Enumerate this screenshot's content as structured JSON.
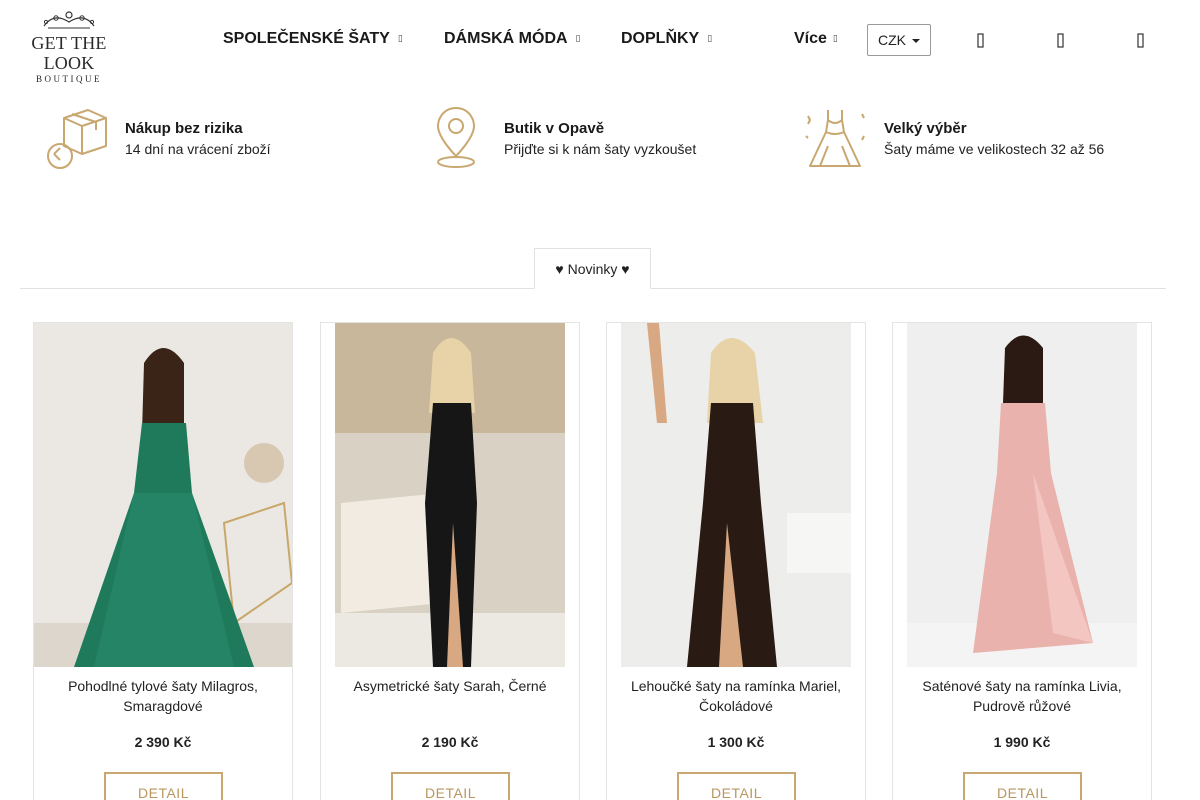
{
  "header": {
    "logo": {
      "brand": "GET THE LOOK",
      "sub": "BOUTIQUE"
    },
    "nav": [
      {
        "label": "SPOLEČENSKÉ ŠATY",
        "caret": "▯"
      },
      {
        "label": "DÁMSKÁ MÓDA",
        "caret": "▯"
      },
      {
        "label": "DOPLŇKY",
        "caret": "▯"
      }
    ],
    "more": {
      "label": "Více",
      "caret": "▯"
    },
    "currency": "CZK",
    "icons": [
      "search-icon",
      "user-icon",
      "cart-icon"
    ]
  },
  "benefits": [
    {
      "title": "Nákup bez rizika",
      "text": "14 dní na vrácení zboží",
      "icon": "return-box-icon"
    },
    {
      "title": "Butik v Opavě",
      "text": "Přijďte si k nám šaty vyzkoušet",
      "icon": "location-pin-icon"
    },
    {
      "title": "Velký výběr",
      "text": "Šaty máme ve velikostech 32 až 56",
      "icon": "dress-icon"
    }
  ],
  "tabs": [
    {
      "label": "♥ Novinky ♥"
    }
  ],
  "products": [
    {
      "name": "Pohodlné tylové šaty Milagros, Smaragdové",
      "price": "2 390 Kč",
      "detail": "DETAIL",
      "dress_color": "#1f7a5c",
      "bg_color": "#ebe8e3"
    },
    {
      "name": "Asymetrické šaty Sarah, Černé",
      "price": "2 190 Kč",
      "detail": "DETAIL",
      "dress_color": "#161616",
      "bg_color": "#d9d2c4"
    },
    {
      "name": "Lehoučké šaty na ramínka Mariel, Čokoládové",
      "price": "1 300 Kč",
      "detail": "DETAIL",
      "dress_color": "#2a1a14",
      "bg_color": "#ededeb"
    },
    {
      "name": "Saténové šaty na ramínka Livia, Pudrově růžové",
      "price": "1 990 Kč",
      "detail": "DETAIL",
      "dress_color": "#eab2ad",
      "bg_color": "#efefef"
    }
  ],
  "colors": {
    "accent_gold": "#c9a770",
    "border": "#e4e4e4"
  }
}
